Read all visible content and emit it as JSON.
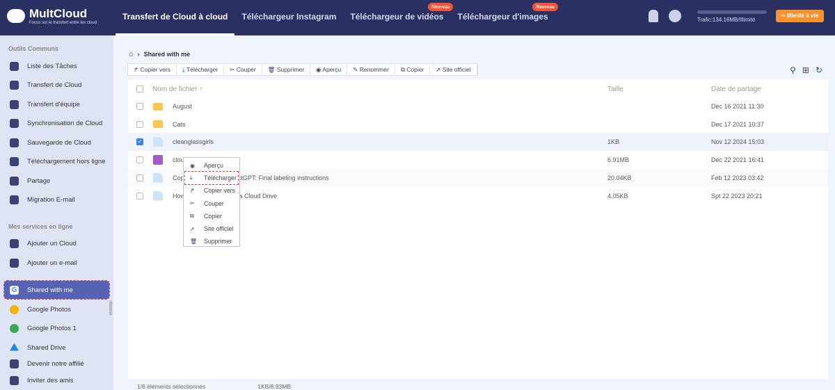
{
  "header": {
    "logo_title": "MultCloud",
    "logo_subtitle": "Focus sur le transfert entre les cloud",
    "nav": [
      {
        "label": "Transfert de Cloud à cloud",
        "active": true
      },
      {
        "label": "Téléchargeur Instagram"
      },
      {
        "label": "Téléchargeur de vidéos",
        "badge": "Nouveau"
      },
      {
        "label": "Téléchargeur d'images",
        "badge": "Nouveau"
      }
    ],
    "traffic": "Trafic:134.16MB/Illimité",
    "upgrade": "∞ Illimité à vie"
  },
  "sidebar": {
    "section1": "Outils Communs",
    "tools": [
      "Liste des Tâches",
      "Transfert de Cloud",
      "Transfert d'équipe",
      "Synchronisation de Cloud",
      "Sauvegarde de Cloud",
      "Téléchargement hors ligne",
      "Partage",
      "Migration E-mail"
    ],
    "section2": "Mes services en ligne",
    "services": [
      "Ajouter un Cloud",
      "Ajouter un e-mail",
      "Shared with me",
      "Google Photos",
      "Google Photos 1",
      "Shared Drive",
      "Devenir notre affilié",
      "Inviter des amis"
    ]
  },
  "breadcrumb": "Shared with me",
  "toolbar": [
    "Copier vers",
    "Télécharger",
    "Couper",
    "Supprimer",
    "Aperçu",
    "Renommer",
    "Copier",
    "Site officiel"
  ],
  "table": {
    "headers": {
      "name": "Nom de fichier ↑",
      "size": "Taille",
      "date": "Date de partage"
    },
    "rows": [
      {
        "name": "August",
        "size": "",
        "date": "Dec 16 2021 11:30"
      },
      {
        "name": "Cats",
        "size": "",
        "date": "Dec 17 2021 10:37"
      },
      {
        "name": "cleanglassgirls",
        "size": "1KB",
        "date": "Nov 12 2024 15:03"
      },
      {
        "name": "clou",
        "size": "6.91MB",
        "date": "Dec 22 2021 16:41"
      },
      {
        "name": "Cop                   :] InstructGPT: Final labeling instructions",
        "size": "20.04KB",
        "date": "Feb 12 2023 03:42"
      },
      {
        "name": "How                        Mega Cloud Drive",
        "size": "4.05KB",
        "date": "Spt 22 2023 20:21"
      }
    ]
  },
  "context_menu": [
    "Aperçu",
    "Télécharger",
    "Copier vers",
    "Couper",
    "Copier",
    "Site officiel",
    "Supprimer"
  ],
  "footer": {
    "selected": "1/6 éléments sélectionnés",
    "size": "1KB/6.93MB"
  }
}
